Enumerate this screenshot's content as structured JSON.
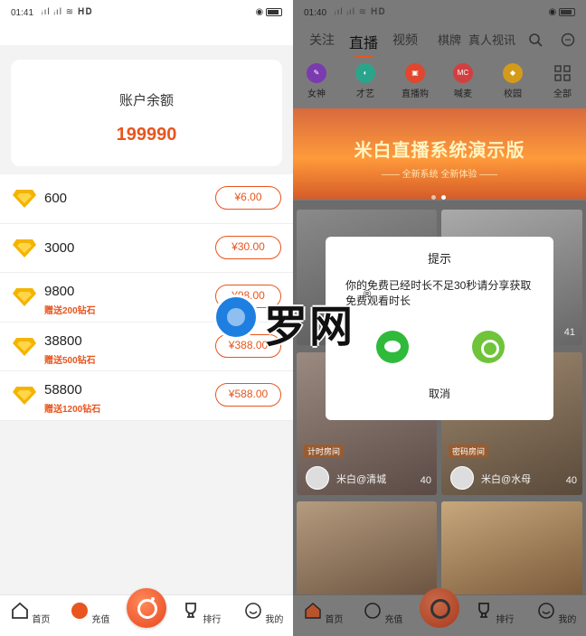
{
  "left": {
    "status": {
      "time": "01:41",
      "signal": "ᵢıl ᵢıl ≋ 𝐇𝐃",
      "battery_icon": "battery-icon"
    },
    "balance": {
      "title": "账户余额",
      "value": "199990"
    },
    "options": [
      {
        "amount": "600",
        "bonus": "",
        "price": "¥6.00"
      },
      {
        "amount": "3000",
        "bonus": "",
        "price": "¥30.00"
      },
      {
        "amount": "9800",
        "bonus": "赠送200钻石",
        "price": "¥98.00"
      },
      {
        "amount": "38800",
        "bonus": "赠送500钻石",
        "price": "¥388.00"
      },
      {
        "amount": "58800",
        "bonus": "赠送1200钻石",
        "price": "¥588.00"
      }
    ],
    "tabs": [
      "首页",
      "充值",
      "排行",
      "我的"
    ]
  },
  "right": {
    "status": {
      "time": "01:40",
      "signal": "ᵢıl ᵢıl ≋ 𝐇𝐃"
    },
    "nav": [
      "关注",
      "直播",
      "视频",
      "棋牌",
      "真人视讯"
    ],
    "categories": [
      {
        "label": "女神",
        "badge": "",
        "color": "#7b3ab0"
      },
      {
        "label": "才艺",
        "badge": "",
        "color": "#2aa58c"
      },
      {
        "label": "直播购",
        "badge": "",
        "color": "#e0472e"
      },
      {
        "label": "喊麦",
        "badge": "MC",
        "color": "#d23f3f"
      },
      {
        "label": "校园",
        "badge": "",
        "color": "#d49a1a"
      },
      {
        "label": "全部",
        "badge": "",
        "color": ""
      }
    ],
    "banner": {
      "title": "米白直播系统演示版",
      "subtitle": "—— 全新系统 全新体验 ——"
    },
    "cards": [
      {
        "tag": "",
        "name": "",
        "count": "41"
      },
      {
        "tag": "计时房间",
        "name": "米白@清城",
        "count": "40"
      },
      {
        "tag": "密码房间",
        "name": "米白@水母",
        "count": "40"
      }
    ],
    "dialog": {
      "title": "提示",
      "message": "你的免费已经时长不足30秒请分享获取免费观看时长",
      "cancel": "取消"
    },
    "tabs": [
      "首页",
      "充值",
      "排行",
      "我的"
    ]
  },
  "watermark": {
    "text": "罗网",
    "mark": "®"
  }
}
